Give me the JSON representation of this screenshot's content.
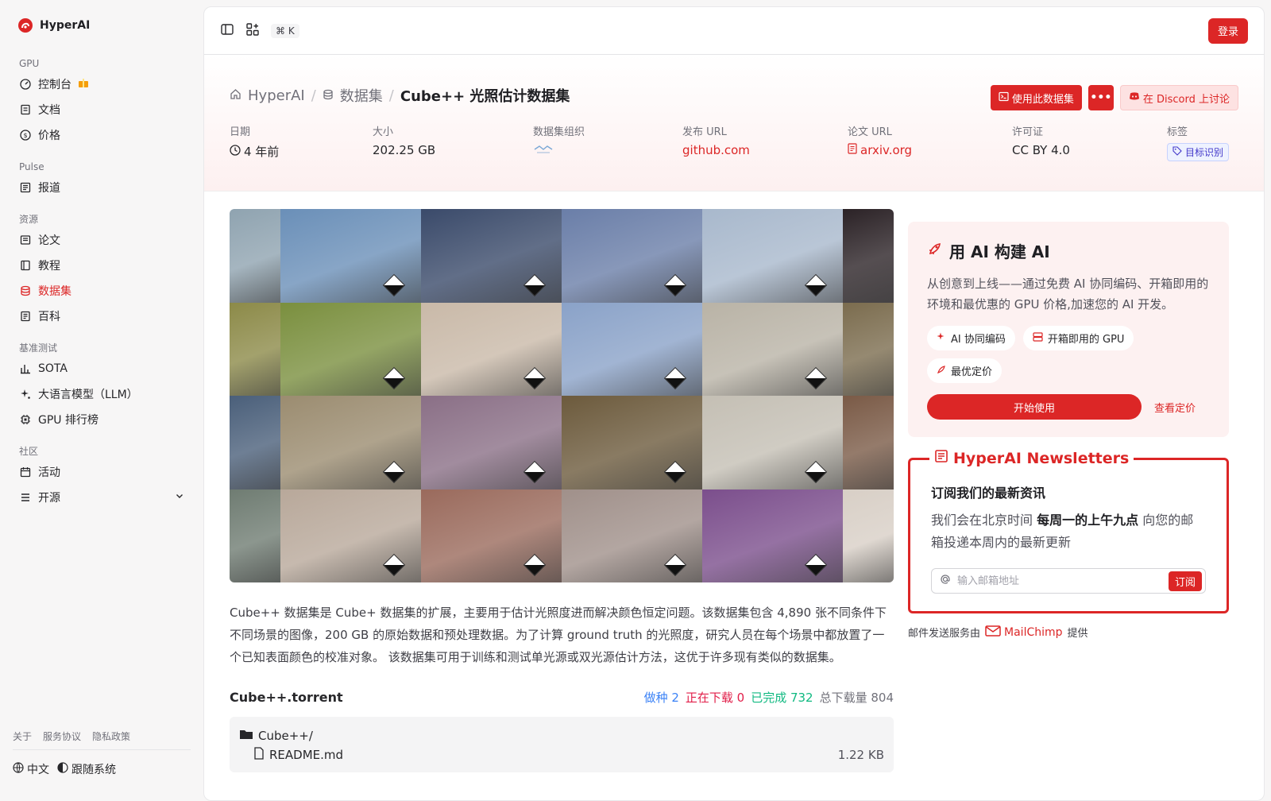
{
  "brand": {
    "name": "HyperAI"
  },
  "sidebar": {
    "groups": [
      {
        "label": "GPU",
        "items": [
          {
            "label": "控制台"
          },
          {
            "label": "文档"
          },
          {
            "label": "价格"
          }
        ]
      },
      {
        "label": "Pulse",
        "items": [
          {
            "label": "报道"
          }
        ]
      },
      {
        "label": "资源",
        "items": [
          {
            "label": "论文"
          },
          {
            "label": "教程"
          },
          {
            "label": "数据集"
          },
          {
            "label": "百科"
          }
        ]
      },
      {
        "label": "基准测试",
        "items": [
          {
            "label": "SOTA"
          },
          {
            "label": "大语言模型（LLM）"
          },
          {
            "label": "GPU 排行榜"
          }
        ]
      },
      {
        "label": "社区",
        "items": [
          {
            "label": "活动"
          },
          {
            "label": "开源"
          }
        ]
      }
    ],
    "active_item": "数据集",
    "footer_links": [
      "关于",
      "服务协议",
      "隐私政策"
    ],
    "footer_tools": {
      "language": "中文",
      "theme": "跟随系统"
    }
  },
  "topbar": {
    "shortcut": "⌘ K",
    "login_label": "登录"
  },
  "breadcrumb": {
    "home": "HyperAI",
    "section": "数据集",
    "current": "Cube++ 光照估计数据集"
  },
  "actions": {
    "use_dataset": "使用此数据集",
    "more": "•••",
    "discord": "在 Discord 上讨论"
  },
  "meta": {
    "date": {
      "label": "日期",
      "value": "4 年前"
    },
    "size": {
      "label": "大小",
      "value": "202.25 GB"
    },
    "org": {
      "label": "数据集组织"
    },
    "publish_url": {
      "label": "发布 URL",
      "value": "github.com"
    },
    "paper_url": {
      "label": "论文 URL",
      "value": "arxiv.org"
    },
    "license": {
      "label": "许可证",
      "value": "CC BY 4.0"
    },
    "tags": {
      "label": "标签",
      "value": "目标识别"
    }
  },
  "description": "Cube++ 数据集是 Cube+ 数据集的扩展，主要用于估计光照度进而解决颜色恒定问题。该数据集包含 4,890 张不同条件下不同场景的图像，200 GB 的原始数据和预处理数据。为了计算 ground truth 的光照度，研究人员在每个场景中都放置了一个已知表面颜色的校准对象。 该数据集可用于训练和测试单光源或双光源估计方法，这优于许多现有类似的数据集。",
  "torrent": {
    "title": "Cube++.torrent",
    "seeding": "做种 2",
    "downloading": "正在下载 0",
    "completed": "已完成 732",
    "total": "总下载量 804",
    "files": [
      {
        "name": "Cube++/",
        "size": ""
      },
      {
        "name": "README.md",
        "size": "1.22 KB"
      }
    ]
  },
  "ai_card": {
    "title": "用 AI 构建 AI",
    "desc": "从创意到上线——通过免费 AI 协同编码、开箱即用的环境和最优惠的 GPU 价格,加速您的 AI 开发。",
    "pills": [
      "AI 协同编码",
      "开箱即用的 GPU",
      "最优定价"
    ],
    "start": "开始使用",
    "pricing": "查看定价"
  },
  "newsletter": {
    "legend": "HyperAI Newsletters",
    "heading": "订阅我们的最新资讯",
    "text_pre": "我们会在北京时间 ",
    "text_bold": "每周一的上午九点",
    "text_post": " 向您的邮箱投递本周内的最新更新",
    "placeholder": "输入邮箱地址",
    "subscribe": "订阅",
    "note_pre": "邮件发送服务由",
    "note_brand": "MailChimp",
    "note_post": "提供"
  },
  "colors": {
    "accent": "#dc2626",
    "seeding": "#3b82f6",
    "downloading": "#e11d48",
    "completed": "#10b981",
    "total": "#71717a"
  },
  "mosaic_tiles": [
    "#8fa3b0",
    "#6a8fb8",
    "#3a4a6a",
    "#6a7ea8",
    "#a8b8cc",
    "#2b2226",
    "#8c8a48",
    "#7a8f3e",
    "#c9b9a8",
    "#8aa2c8",
    "#b9b3a6",
    "#7b6c4e",
    "#4a5f7a",
    "#9b8c70",
    "#8a6f86",
    "#6c5a3c",
    "#c4bfb4",
    "#7a5a46",
    "#6f7c72",
    "#b8a89a",
    "#9a6a5c",
    "#a0908a",
    "#7b4e8c",
    "#d8cfc6"
  ]
}
